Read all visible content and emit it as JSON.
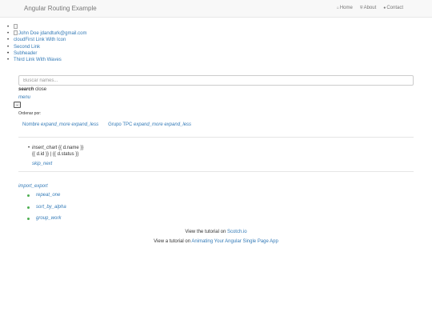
{
  "navbar": {
    "brand": "Angular Routing Example",
    "links": [
      {
        "icon": "home-icon",
        "label": "Home"
      },
      {
        "icon": "shield-icon",
        "label": "About"
      },
      {
        "icon": "comment-icon",
        "label": "Contact"
      }
    ]
  },
  "sidebar": {
    "user_text": "John Doe jdandturk@gmail.com",
    "first_link": "cloudFirst Link With Icon",
    "second_link": "Second Link",
    "subheader": "Subheader",
    "third_link": "Third Link With Waves"
  },
  "search": {
    "placeholder": "Buscar names...",
    "label_icon": "search",
    "label_close": "close"
  },
  "menu_label": "menu",
  "sort": {
    "label": "Ordenar por:",
    "option1_prefix": "Nombre",
    "option1_icons": "expand_more expand_less",
    "option2_prefix": "Grupo TPC",
    "option2_icons": "expand_more expand_less"
  },
  "results": {
    "line1_icon": "insert_chart",
    "line1_text": "{{ d.name }}",
    "line2_text": "{{ d.id }} | {{ d.status }}",
    "skip": "skip_next"
  },
  "import_export": "import_export",
  "menu_items": [
    "repeat_one",
    "sort_by_alpha",
    "group_work"
  ],
  "footer": {
    "line1_prefix": "View the tutorial on",
    "line1_link": "Scotch.io",
    "line2_prefix": "View a tutorial on",
    "line2_link": "Animating Your Angular Single Page App"
  },
  "colors": {
    "navbar_bg": "#f8f8f8",
    "link": "#337ab7",
    "bullet_green": "#4caf50"
  }
}
